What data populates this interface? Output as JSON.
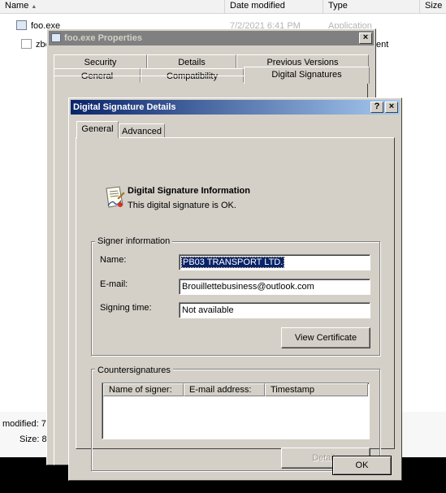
{
  "explorer": {
    "columns": [
      {
        "label": "Name"
      },
      {
        "label": "Date modified"
      },
      {
        "label": "Type"
      },
      {
        "label": "Size"
      }
    ],
    "files": [
      {
        "name": "foo.exe",
        "date": "7/2/2021 6:41 PM",
        "type": "Application"
      },
      {
        "name": "zbc",
        "type_suffix": "ent"
      }
    ],
    "details": {
      "modified_label": "modified:",
      "modified_value": "7",
      "size_label": "Size:",
      "size_value": "8"
    }
  },
  "properties": {
    "title": "foo.exe Properties",
    "tabs_back": [
      "Security",
      "Details",
      "Previous Versions"
    ],
    "tabs_front": [
      "General",
      "Compatibility",
      "Digital Signatures"
    ]
  },
  "signature_details": {
    "title": "Digital Signature Details",
    "help_button": "?",
    "close_button": "×",
    "tabs": [
      "General",
      "Advanced"
    ],
    "info_heading": "Digital Signature Information",
    "info_status": "This digital signature is OK.",
    "signer_group": "Signer information",
    "name_label": "Name:",
    "name_value": "PB03 TRANSPORT LTD.",
    "email_label": "E-mail:",
    "email_value": "Brouillettebusiness@outlook.com",
    "signing_time_label": "Signing time:",
    "signing_time_value": "Not available",
    "view_certificate_button": "View Certificate",
    "countersignatures_group": "Countersignatures",
    "counter_columns": [
      "Name of signer:",
      "E-mail address:",
      "Timestamp"
    ],
    "details_button": "Details",
    "ok_button": "OK"
  },
  "colors": {
    "active_title_start": "#0a246a",
    "active_title_end": "#a6caf0",
    "inactive_title": "#808080",
    "dialog_face": "#d4d0c8",
    "selection": "#0a246a"
  }
}
